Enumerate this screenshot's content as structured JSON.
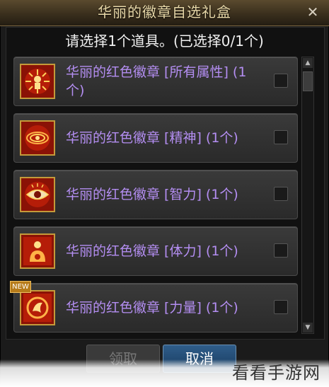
{
  "window": {
    "title": "华丽的徽章自选礼盒",
    "close_label": "✕"
  },
  "instruction": "请选择1个道具。(已选择0/1个)",
  "items": [
    {
      "label": "华丽的红色徽章 [所有属性] (1个)",
      "icon": "all-attributes-badge-icon"
    },
    {
      "label": "华丽的红色徽章 [精神] (1个)",
      "icon": "spirit-badge-icon"
    },
    {
      "label": "华丽的红色徽章 [智力] (1个)",
      "icon": "intelligence-badge-icon"
    },
    {
      "label": "华丽的红色徽章 [体力] (1个)",
      "icon": "vitality-badge-icon"
    },
    {
      "label": "华丽的红色徽章 [力量] (1个)",
      "icon": "strength-badge-icon"
    }
  ],
  "new_tag": "NEW",
  "buttons": {
    "confirm": "领取",
    "cancel": "取消"
  },
  "watermark": "看看手游网",
  "colors": {
    "item_text": "#b48ef2",
    "badge_red": "#8a1206",
    "badge_border": "#c49a3a",
    "title_text": "#e8d8a8"
  }
}
